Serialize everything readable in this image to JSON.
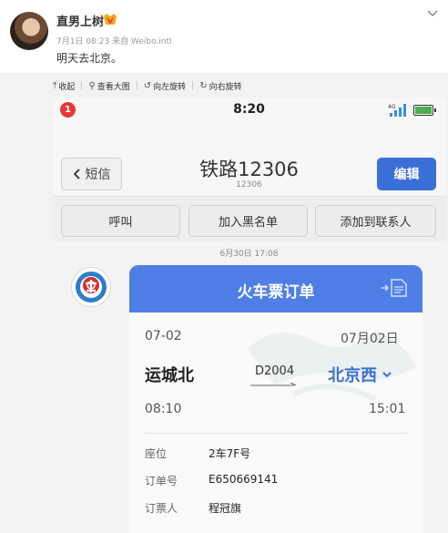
{
  "post": {
    "username": "直男上树",
    "meta": "7月1日 08:23 来自 Weibo.intl",
    "text": "明天去北京。"
  },
  "image_toolbar": {
    "items": [
      {
        "icon": "collapse-icon",
        "glyph": "⤒",
        "label": "收起"
      },
      {
        "icon": "zoom-icon",
        "glyph": "⚲",
        "label": "查看大图"
      },
      {
        "icon": "rotate-left-icon",
        "glyph": "↺",
        "label": "向左旋转"
      },
      {
        "icon": "rotate-right-icon",
        "glyph": "↻",
        "label": "向右旋转"
      }
    ]
  },
  "phone": {
    "status": {
      "notification_count": "1",
      "time": "8:20",
      "network": "4G"
    },
    "nav": {
      "back_label": "短信",
      "title": "铁路12306",
      "subtitle": "12306",
      "edit_label": "编辑"
    },
    "actions": {
      "call": "呼叫",
      "blacklist": "加入黑名单",
      "add_contact": "添加到联系人"
    },
    "chat": {
      "timestamp": "6月30日 17:08",
      "card": {
        "title": "火车票订单",
        "date_left": "07-02",
        "date_right": "07月02日",
        "from_station": "运城北",
        "train_no": "D2004",
        "to_station": "北京西",
        "depart_time": "08:10",
        "arrive_time": "15:01",
        "seat_label": "座位",
        "seat_value": "2车7F号",
        "order_label": "订单号",
        "order_value": "E650669141",
        "booker_label": "订票人",
        "booker_value": "程冠旗"
      }
    },
    "colors": {
      "accent": "#3b6fd8",
      "card_header": "#4f7fe6",
      "notification": "#e53935"
    }
  }
}
